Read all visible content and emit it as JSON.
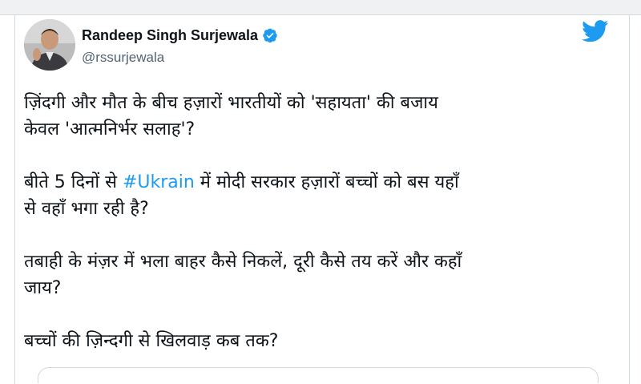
{
  "tweet": {
    "author": {
      "name": "Randeep Singh Surjewala",
      "handle": "@rssurjewala",
      "avatar_icon": "profile-photo",
      "verified": true,
      "verified_color": "#1d9bf0"
    },
    "platform_icon": "twitter-bird-icon",
    "platform_color": "#1d9bf0",
    "paragraphs": [
      {
        "line1": "ज़िंदगी और मौत के बीच हज़ारों भारतीयों को 'सहायता' की बजाय",
        "line2": "केवल 'आत्मनिर्भर सलाह'?"
      },
      {
        "before": "बीते 5 दिनों से ",
        "hashtag": "#Ukrain",
        "after": " में मोदी सरकार हज़ारों बच्चों को बस यहाँ",
        "line2": "से वहाँ भगा रही है?"
      },
      {
        "line1": "तबाही के मंज़र में भला बाहर कैसे निकलें, दूरी कैसे तय करें और कहाँ",
        "line2": "जाय?"
      },
      {
        "line1": "बच्चों की ज़िन्दगी से खिलवाड़ कब तक?"
      }
    ],
    "hashtag_color": "#1d9bf0"
  }
}
